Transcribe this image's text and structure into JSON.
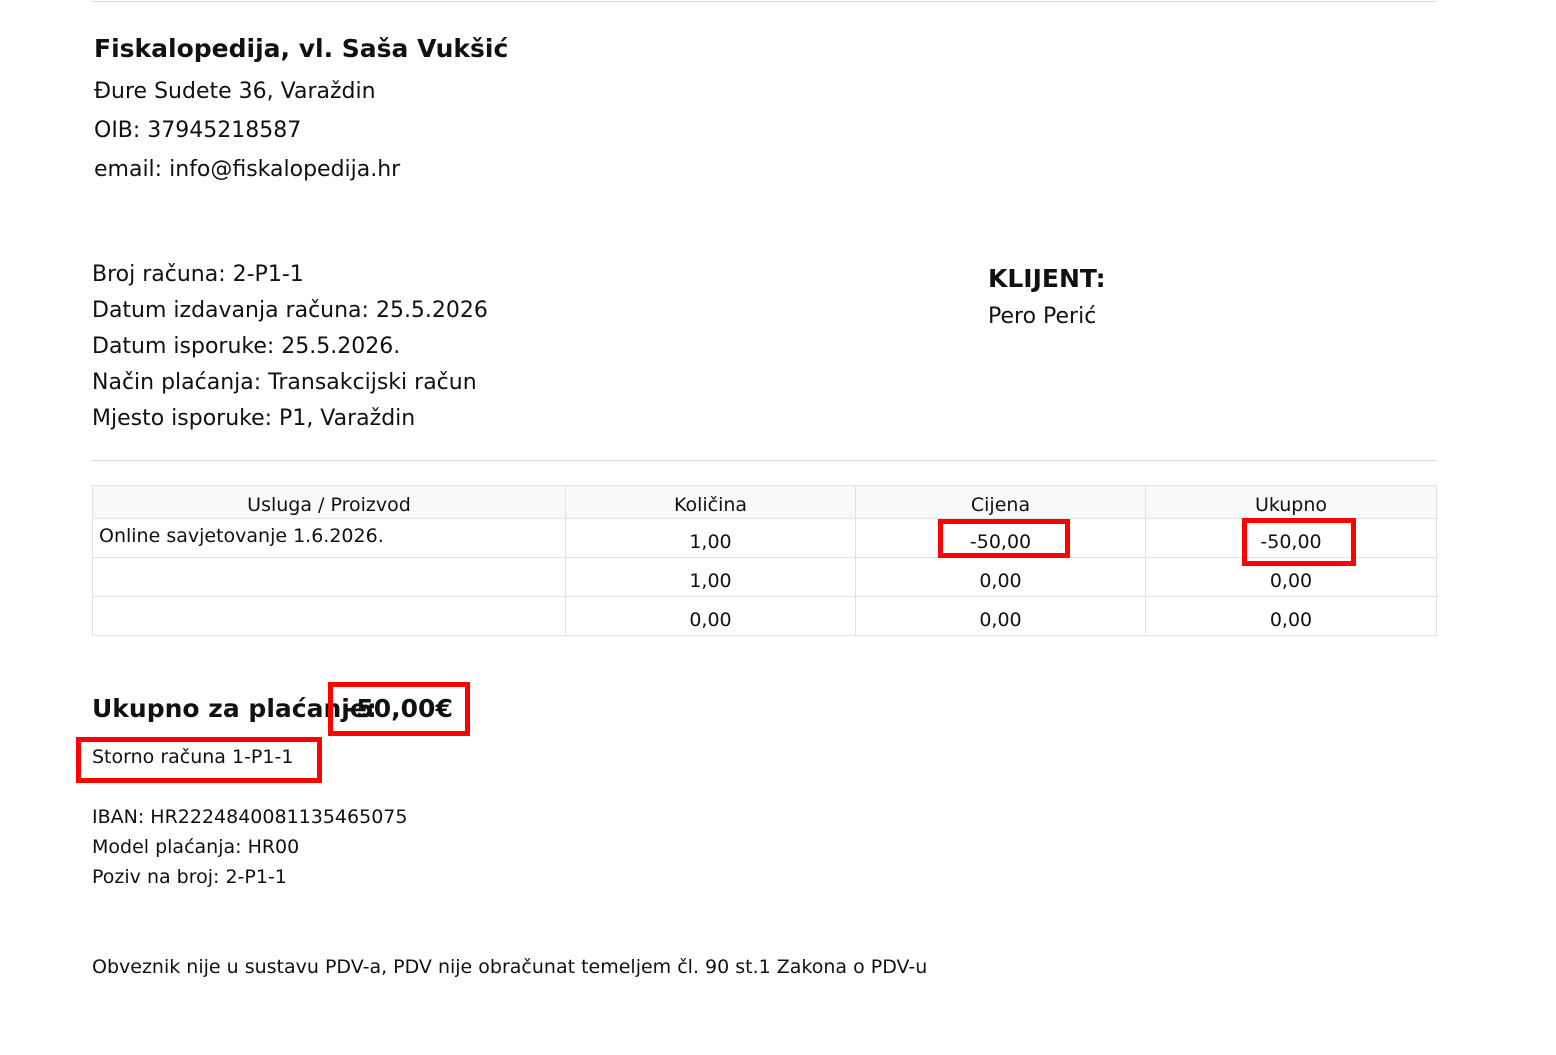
{
  "company": {
    "name": "Fiskalopedija, vl. Saša Vukšić",
    "address": "Đure Sudete 36, Varaždin",
    "oib": "OIB: 37945218587",
    "email": "email: info@fiskalopedija.hr"
  },
  "invoice": {
    "number": "Broj računa: 2-P1-1",
    "issue_date": "Datum izdavanja računa: 25.5.2026",
    "delivery_date": "Datum isporuke: 25.5.2026.",
    "payment_method": "Način plaćanja: Transakcijski račun",
    "delivery_place": "Mjesto isporuke: P1, Varaždin"
  },
  "client": {
    "label": "KLIJENT:",
    "name": "Pero Perić"
  },
  "table": {
    "headers": [
      "Usluga / Proizvod",
      "Količina",
      "Cijena",
      "Ukupno"
    ],
    "rows": [
      [
        "Online savjetovanje 1.6.2026.",
        "1,00",
        "-50,00",
        "-50,00"
      ],
      [
        "",
        "1,00",
        "0,00",
        "0,00"
      ],
      [
        "",
        "0,00",
        "0,00",
        "0,00"
      ]
    ]
  },
  "totals": {
    "label": "Ukupno za plaćanje:",
    "value": "-50,00€",
    "storno": "Storno računa 1-P1-1"
  },
  "payment": {
    "iban": "IBAN: HR2224840081135465075",
    "model": "Model plaćanja: HR00",
    "reference": "Poziv na broj: 2-P1-1"
  },
  "footer": {
    "vat_note": "Obveznik nije u sustavu PDV-a, PDV nije obračunat temeljem čl. 90 st.1 Zakona o PDV-u"
  },
  "highlight_color": "#ff0000"
}
